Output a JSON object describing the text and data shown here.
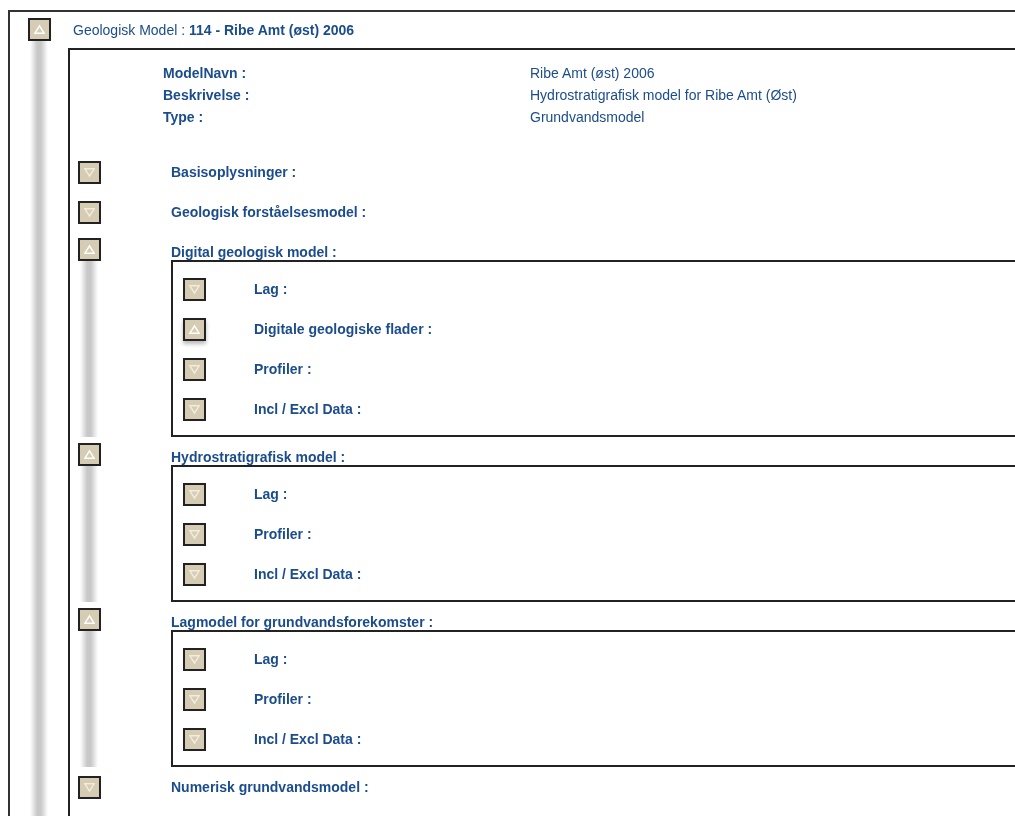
{
  "model": {
    "title": "Geologisk Model : **114 - Ribe Amt (øst) 2006**",
    "expanded": true,
    "fields": [
      {
        "label": "ModelNavn :",
        "value": "Ribe Amt (øst) 2006"
      },
      {
        "label": "Beskrivelse :",
        "value": "Hydrostratigrafisk model for Ribe Amt (Øst)"
      },
      {
        "label": "Type :",
        "value": "Grundvandsmodel"
      }
    ],
    "sections": [
      {
        "label": "Basisoplysninger :",
        "expanded": false
      },
      {
        "label": "Geologisk forståelsesmodel :",
        "expanded": false
      },
      {
        "label": "Digital geologisk model :",
        "expanded": true,
        "children": [
          {
            "label": "Lag :",
            "expanded": false
          },
          {
            "label": "Digitale geologiske flader :",
            "expanded": true
          },
          {
            "label": "Profiler :",
            "expanded": false
          },
          {
            "label": "Incl / Excl Data :",
            "expanded": false
          }
        ]
      },
      {
        "label": "Hydrostratigrafisk model :",
        "expanded": true,
        "children": [
          {
            "label": "Lag :",
            "expanded": false
          },
          {
            "label": "Profiler :",
            "expanded": false
          },
          {
            "label": "Incl / Excl Data :",
            "expanded": false
          }
        ]
      },
      {
        "label": "Lagmodel for grundvandsforekomster :",
        "expanded": true,
        "children": [
          {
            "label": "Lag :",
            "expanded": false
          },
          {
            "label": "Profiler :",
            "expanded": false
          },
          {
            "label": "Incl / Excl Data :",
            "expanded": false
          }
        ]
      },
      {
        "label": "Numerisk grundvandsmodel :",
        "expanded": false
      }
    ]
  }
}
